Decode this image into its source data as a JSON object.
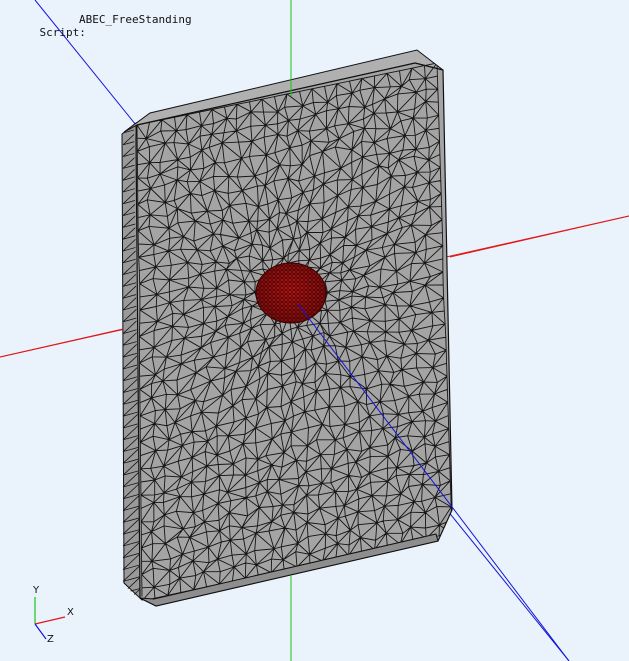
{
  "header": {
    "script_label": "Script:",
    "script_name": "ABEC_FreeStanding"
  },
  "triad": {
    "x_label": "X",
    "y_label": "Y",
    "z_label": "Z"
  },
  "colors": {
    "background": "#eaf3fc",
    "axis_x": "#e01818",
    "axis_y": "#19c219",
    "axis_z": "#1414d8",
    "panel_fill": "#a4a4a4",
    "mesh_line": "#151515",
    "driver_fill": "#b41212"
  },
  "icons": {
    "triad": "xyz-axes-triad-icon"
  }
}
